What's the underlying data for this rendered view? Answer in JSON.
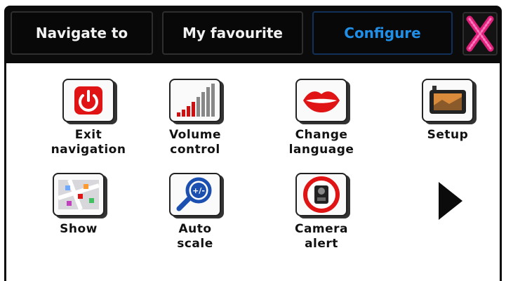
{
  "tabs": {
    "navigate_to": "Navigate to",
    "my_favourite": "My favourite",
    "configure": "Configure",
    "active": "configure"
  },
  "colors": {
    "active_tab": "#1f8fe8",
    "close_icon": "#e0207a",
    "icon_red": "#e01010"
  },
  "menu": {
    "items": [
      {
        "label": "Exit\nnavigation",
        "icon": "power-icon"
      },
      {
        "label": "Volume\ncontrol",
        "icon": "volume-bars-icon"
      },
      {
        "label": "Change\nlanguage",
        "icon": "lips-icon"
      },
      {
        "label": "Setup",
        "icon": "device-icon"
      },
      {
        "label": "Show",
        "icon": "map-icon"
      },
      {
        "label": "Auto\nscale",
        "icon": "magnifier-zoom-icon"
      },
      {
        "label": "Camera\nalert",
        "icon": "speed-camera-icon"
      }
    ],
    "auto_scale_glyph": "+/-",
    "next_icon": "play-arrow-icon",
    "close_icon": "close-x-icon"
  }
}
